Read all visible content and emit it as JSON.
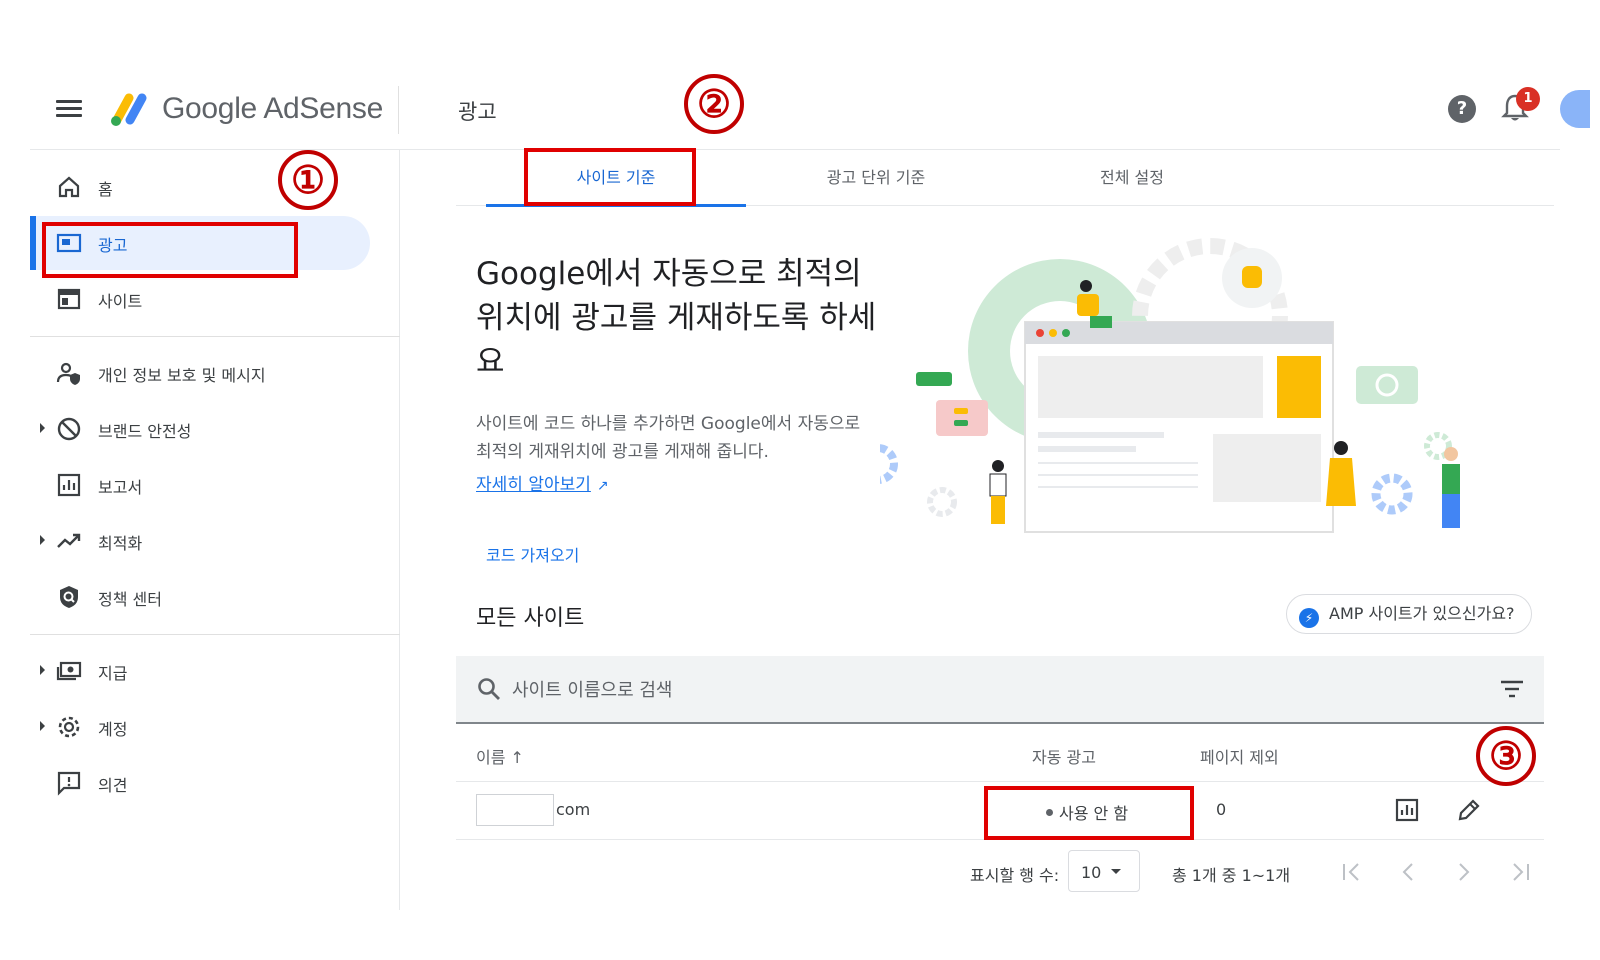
{
  "header": {
    "logo_text": "Google AdSense",
    "page_title": "광고",
    "notification_count": "1"
  },
  "sidebar": {
    "items": [
      {
        "label": "홈",
        "icon": "home-icon"
      },
      {
        "label": "광고",
        "icon": "ads-icon",
        "active": true
      },
      {
        "label": "사이트",
        "icon": "sites-icon"
      },
      {
        "label": "개인 정보 보호 및 메시지",
        "icon": "privacy-icon"
      },
      {
        "label": "브랜드 안전성",
        "icon": "block-icon",
        "expandable": true
      },
      {
        "label": "보고서",
        "icon": "reports-icon"
      },
      {
        "label": "최적화",
        "icon": "trending-icon",
        "expandable": true
      },
      {
        "label": "정책 센터",
        "icon": "policy-shield-icon"
      },
      {
        "label": "지급",
        "icon": "payments-icon",
        "expandable": true
      },
      {
        "label": "계정",
        "icon": "settings-icon",
        "expandable": true
      },
      {
        "label": "의견",
        "icon": "feedback-icon"
      }
    ]
  },
  "tabs": [
    {
      "label": "사이트 기준",
      "active": true
    },
    {
      "label": "광고 단위 기준"
    },
    {
      "label": "전체 설정"
    }
  ],
  "hero": {
    "title": "Google에서 자동으로 최적의 위치에 광고를 게재하도록 하세요",
    "description": "사이트에 코드 하나를 추가하면 Google에서 자동으로 최적의 게재위치에 광고를 게재해 줍니다.",
    "learn_more": "자세히 알아보기",
    "get_code": "코드 가져오기"
  },
  "sites": {
    "title": "모든 사이트",
    "amp_prompt": "AMP 사이트가 있으신가요?",
    "search_placeholder": "사이트 이름으로 검색",
    "columns": {
      "name": "이름",
      "sort_arrow": "↑",
      "auto_ads": "자동 광고",
      "excluded_pages": "페이지 제외"
    },
    "rows": [
      {
        "site_suffix": "com",
        "auto_ads": "사용 안 함",
        "excluded_pages": "0"
      }
    ],
    "pagination": {
      "rows_label": "표시할 행 수:",
      "rows_value": "10",
      "range": "총 1개 중 1~1개"
    }
  },
  "annotations": {
    "marker_1": "①",
    "marker_2": "②",
    "marker_3": "③",
    "color": "#e00000"
  },
  "colors": {
    "accent": "#1a73e8",
    "active_bg": "#e8f0fe",
    "badge": "#d93025"
  }
}
